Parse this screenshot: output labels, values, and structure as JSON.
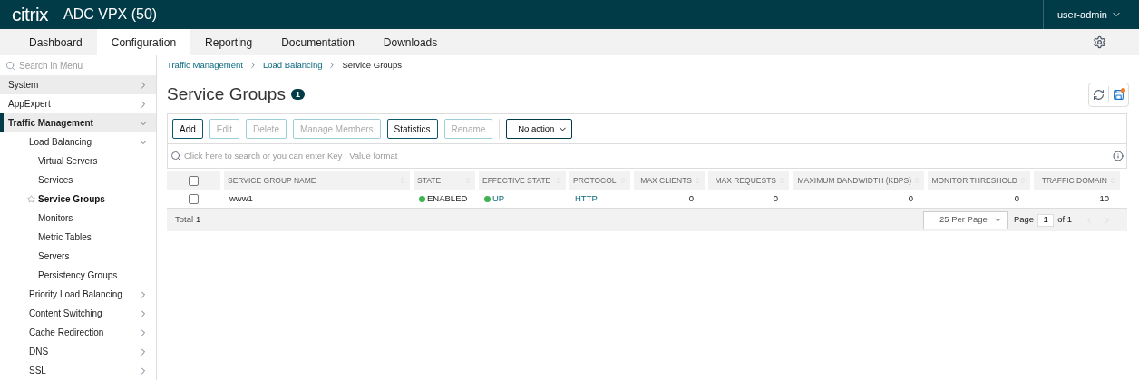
{
  "header": {
    "logo": "citrix",
    "title": "ADC VPX (50)",
    "user": "user-admin"
  },
  "nav_tabs": [
    {
      "label": "Dashboard",
      "selected": false
    },
    {
      "label": "Configuration",
      "selected": true
    },
    {
      "label": "Reporting",
      "selected": false
    },
    {
      "label": "Documentation",
      "selected": false
    },
    {
      "label": "Downloads",
      "selected": false
    }
  ],
  "sidebar": {
    "search": {
      "placeholder": "Search in Menu"
    },
    "items": [
      {
        "label": "System",
        "expanded": false,
        "highlighted": true,
        "selected": false
      },
      {
        "label": "AppExpert",
        "expanded": false,
        "highlighted": false,
        "selected": false
      },
      {
        "label": "Traffic Management",
        "expanded": true,
        "highlighted": true,
        "selected": false,
        "children": [
          {
            "label": "Load Balancing",
            "expanded": true,
            "highlighted": false,
            "selected": false,
            "children": [
              {
                "label": "Virtual Servers",
                "selected": false
              },
              {
                "label": "Services",
                "selected": false
              },
              {
                "label": "Service Groups",
                "selected": true
              },
              {
                "label": "Monitors",
                "selected": false
              },
              {
                "label": "Metric Tables",
                "selected": false
              },
              {
                "label": "Servers",
                "selected": false
              },
              {
                "label": "Persistency Groups",
                "selected": false
              }
            ]
          },
          {
            "label": "Priority Load Balancing",
            "expanded": false,
            "highlighted": false,
            "selected": false
          },
          {
            "label": "Content Switching",
            "expanded": false,
            "highlighted": false,
            "selected": false
          },
          {
            "label": "Cache Redirection",
            "expanded": false,
            "highlighted": false,
            "selected": false
          },
          {
            "label": "DNS",
            "expanded": false,
            "highlighted": false,
            "selected": false
          },
          {
            "label": "SSL",
            "expanded": false,
            "highlighted": false,
            "selected": false
          }
        ]
      }
    ]
  },
  "breadcrumb": [
    {
      "label": "Traffic Management",
      "link": true
    },
    {
      "label": "Load Balancing",
      "link": true
    },
    {
      "label": "Service Groups",
      "link": false
    }
  ],
  "page": {
    "title": "Service Groups",
    "count": "1"
  },
  "toolbar": {
    "buttons": [
      {
        "label": "Add",
        "disabled": false
      },
      {
        "label": "Edit",
        "disabled": true
      },
      {
        "label": "Delete",
        "disabled": true
      },
      {
        "label": "Manage Members",
        "disabled": true
      },
      {
        "label": "Statistics",
        "disabled": false
      },
      {
        "label": "Rename",
        "disabled": true
      }
    ],
    "action_select": "No action"
  },
  "table_search": {
    "placeholder": "Click here to search or you can enter Key : Value format"
  },
  "table": {
    "select_all_checked": false,
    "columns": [
      {
        "label": "SERVICE GROUP NAME"
      },
      {
        "label": "STATE"
      },
      {
        "label": "EFFECTIVE STATE"
      },
      {
        "label": "PROTOCOL"
      },
      {
        "label": "MAX CLIENTS"
      },
      {
        "label": "MAX REQUESTS"
      },
      {
        "label": "MAXIMUM BANDWIDTH (KBPS)"
      },
      {
        "label": "MONITOR THRESHOLD"
      },
      {
        "label": "TRAFFIC DOMAIN"
      }
    ],
    "rows": [
      {
        "checked": false,
        "cells": [
          {
            "text": "www1",
            "kind": "text"
          },
          {
            "text": "ENABLED",
            "kind": "status",
            "color": "#3fb34f"
          },
          {
            "text": "UP",
            "kind": "status-link",
            "color": "#3fb34f"
          },
          {
            "text": "HTTP",
            "kind": "link"
          },
          {
            "text": "0",
            "kind": "text"
          },
          {
            "text": "0",
            "kind": "text"
          },
          {
            "text": "0",
            "kind": "text"
          },
          {
            "text": "0",
            "kind": "text"
          },
          {
            "text": "10",
            "kind": "text"
          }
        ]
      }
    ]
  },
  "footer": {
    "total_label": "Total",
    "total": "1",
    "per_page": "25 Per Page",
    "page_label": "Page",
    "page": "1",
    "of": "of 1"
  }
}
